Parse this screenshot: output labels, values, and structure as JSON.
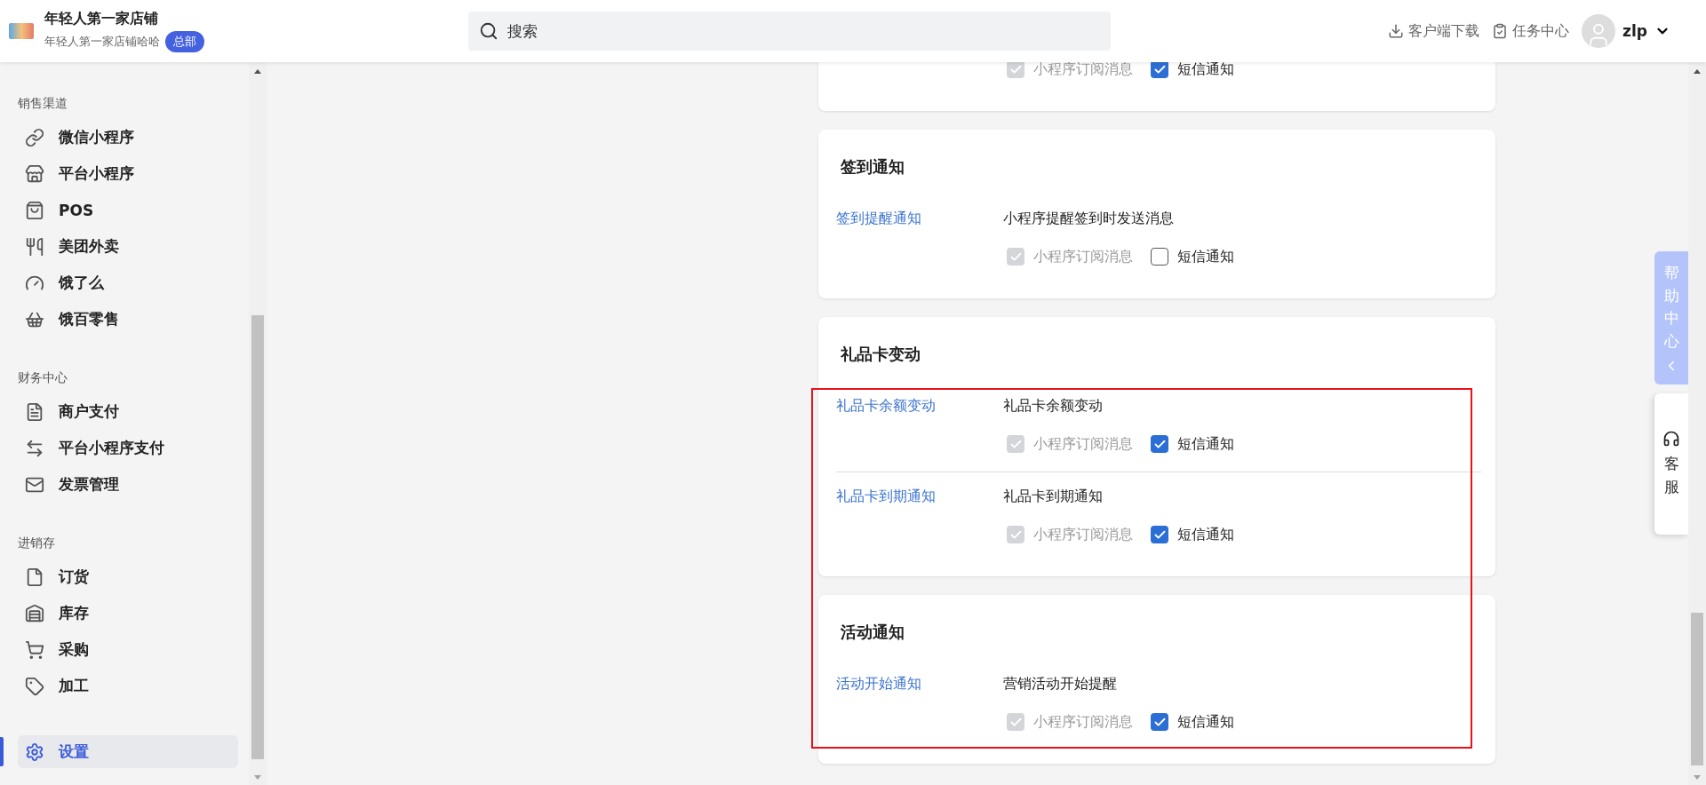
{
  "header": {
    "store_name": "年轻人第一家店铺",
    "store_subtitle": "年轻人第一家店铺哈哈",
    "store_badge": "总部",
    "search": {
      "placeholder": "搜索"
    },
    "actions": [
      {
        "kind": "download",
        "label": "客户端下载"
      },
      {
        "kind": "tasks",
        "label": "任务中心"
      }
    ],
    "user": {
      "name": "zlp"
    }
  },
  "sidebar": {
    "sections": [
      {
        "title": "销售渠道",
        "items": [
          {
            "label": "微信小程序",
            "selected": false
          },
          {
            "label": "平台小程序",
            "selected": false
          },
          {
            "label": "POS",
            "selected": false
          },
          {
            "label": "美团外卖",
            "selected": false
          },
          {
            "label": "饿了么",
            "selected": false
          },
          {
            "label": "饿百零售",
            "selected": false
          }
        ]
      },
      {
        "title": "财务中心",
        "items": [
          {
            "label": "商户支付",
            "selected": false
          },
          {
            "label": "平台小程序支付",
            "selected": false
          },
          {
            "label": "发票管理",
            "selected": false
          }
        ]
      },
      {
        "title": "进销存",
        "items": [
          {
            "label": "订货",
            "selected": false
          },
          {
            "label": "库存",
            "selected": false
          },
          {
            "label": "采购",
            "selected": false
          },
          {
            "label": "加工",
            "selected": false
          }
        ]
      },
      {
        "items": [
          {
            "label": "设置",
            "selected": true
          }
        ]
      }
    ]
  },
  "sections": [
    {
      "rows": [
        {
          "options": [
            {
              "label": "小程序订阅消息",
              "checked": true,
              "disabled": true
            },
            {
              "label": "短信通知",
              "checked": true,
              "disabled": false
            }
          ]
        }
      ]
    },
    {
      "title": "签到通知",
      "rows": [
        {
          "name": "签到提醒通知",
          "description": "小程序提醒签到时发送消息",
          "options": [
            {
              "label": "小程序订阅消息",
              "checked": true,
              "disabled": true
            },
            {
              "label": "短信通知",
              "checked": false,
              "disabled": false
            }
          ]
        }
      ]
    },
    {
      "title": "礼品卡变动",
      "rows": [
        {
          "name": "礼品卡余额变动",
          "description": "礼品卡余额变动",
          "options": [
            {
              "label": "小程序订阅消息",
              "checked": true,
              "disabled": true
            },
            {
              "label": "短信通知",
              "checked": true,
              "disabled": false
            }
          ]
        },
        {
          "name": "礼品卡到期通知",
          "description": "礼品卡到期通知",
          "options": [
            {
              "label": "小程序订阅消息",
              "checked": true,
              "disabled": true
            },
            {
              "label": "短信通知",
              "checked": true,
              "disabled": false
            }
          ]
        }
      ]
    },
    {
      "title": "活动通知",
      "rows": [
        {
          "name": "活动开始通知",
          "description": "营销活动开始提醒",
          "options": [
            {
              "label": "小程序订阅消息",
              "checked": true,
              "disabled": true
            },
            {
              "label": "短信通知",
              "checked": true,
              "disabled": false
            }
          ]
        }
      ]
    }
  ],
  "highlight_frame": true,
  "help_tab": {
    "label": "帮助中心"
  },
  "service_tab": {
    "label": "客服"
  }
}
